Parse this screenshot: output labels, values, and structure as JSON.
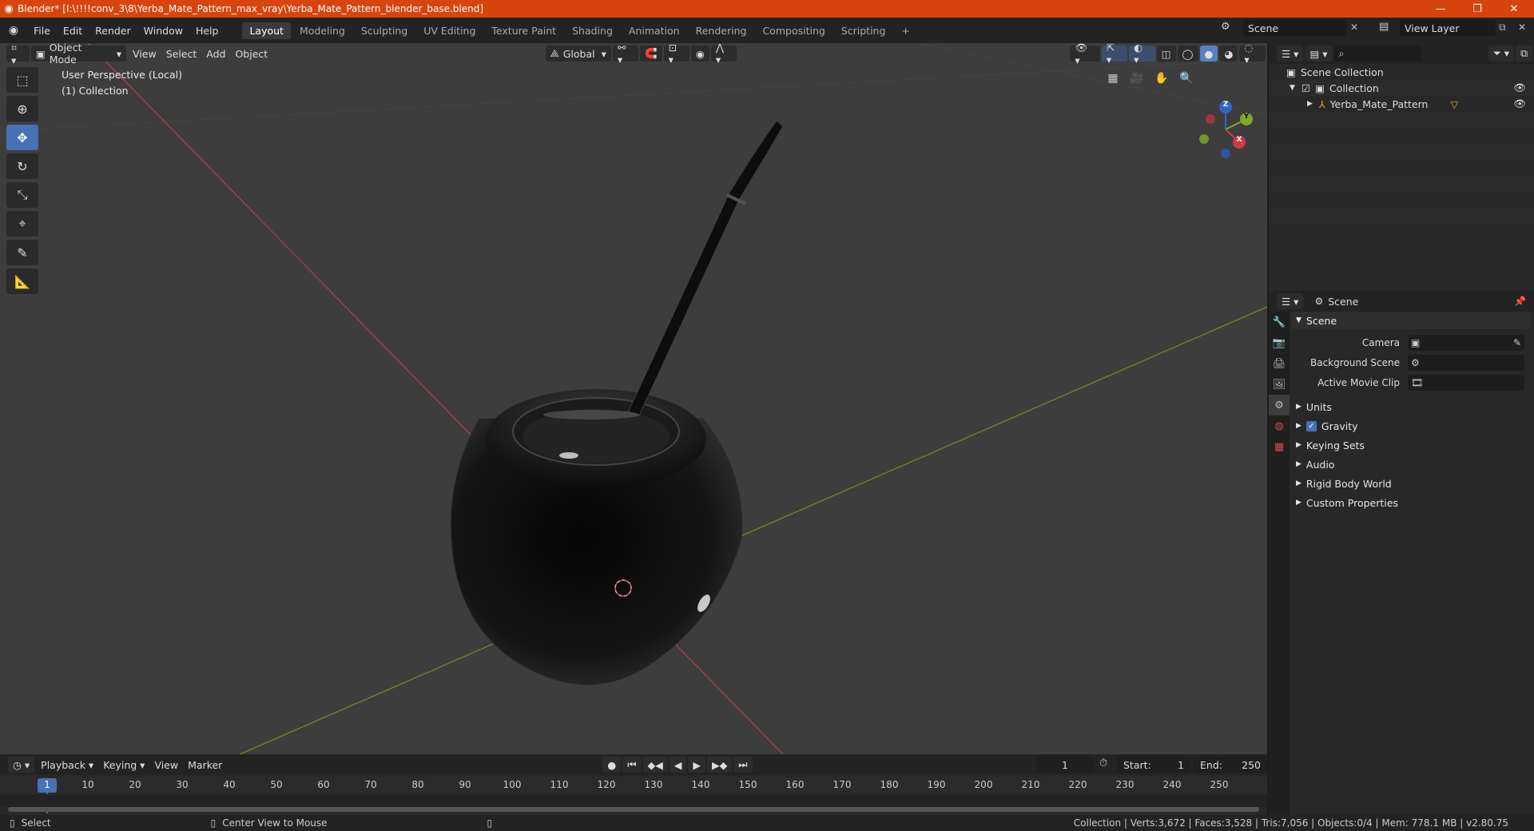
{
  "window": {
    "title": "Blender* [I:\\!!!!conv_3\\8\\Yerba_Mate_Pattern_max_vray\\Yerba_Mate_Pattern_blender_base.blend]",
    "minimize": "—",
    "restore": "❐",
    "close": "✕"
  },
  "menu": [
    "File",
    "Edit",
    "Render",
    "Window",
    "Help"
  ],
  "workspaces": [
    "Layout",
    "Modeling",
    "Sculpting",
    "UV Editing",
    "Texture Paint",
    "Shading",
    "Animation",
    "Rendering",
    "Compositing",
    "Scripting"
  ],
  "add_workspace": "+",
  "scene_selector": "Scene",
  "view_layer": "View Layer",
  "viewport": {
    "mode": "Object Mode",
    "menus": [
      "View",
      "Select",
      "Add",
      "Object"
    ],
    "transform_orientation": "Global",
    "perspective_label": "User Perspective (Local)",
    "collection_label": "(1) Collection",
    "gizmo": {
      "x": "X",
      "y": "Y",
      "z": "Z"
    }
  },
  "outliner": {
    "root": "Scene Collection",
    "collection": "Collection",
    "object": "Yerba_Mate_Pattern"
  },
  "properties": {
    "header": "Scene",
    "panel": "Scene",
    "camera_label": "Camera",
    "background_scene_label": "Background Scene",
    "active_movie_clip_label": "Active Movie Clip",
    "subpanels": [
      "Units",
      "Gravity",
      "Keying Sets",
      "Audio",
      "Rigid Body World",
      "Custom Properties"
    ]
  },
  "timeline": {
    "menus": [
      "Playback",
      "Keying",
      "View",
      "Marker"
    ],
    "current_frame": "1",
    "start_label": "Start:",
    "start": "1",
    "end_label": "End:",
    "end": "250",
    "ruler": [
      "1",
      "10",
      "20",
      "30",
      "40",
      "50",
      "60",
      "70",
      "80",
      "90",
      "100",
      "110",
      "120",
      "130",
      "140",
      "150",
      "160",
      "170",
      "180",
      "190",
      "200",
      "210",
      "220",
      "230",
      "240",
      "250"
    ]
  },
  "status": {
    "select": "Select",
    "center_view": "Center View to Mouse",
    "stats": "Collection | Verts:3,672 | Faces:3,528 | Tris:7,056 | Objects:0/4 | Mem: 778.1 MB | v2.80.75"
  }
}
